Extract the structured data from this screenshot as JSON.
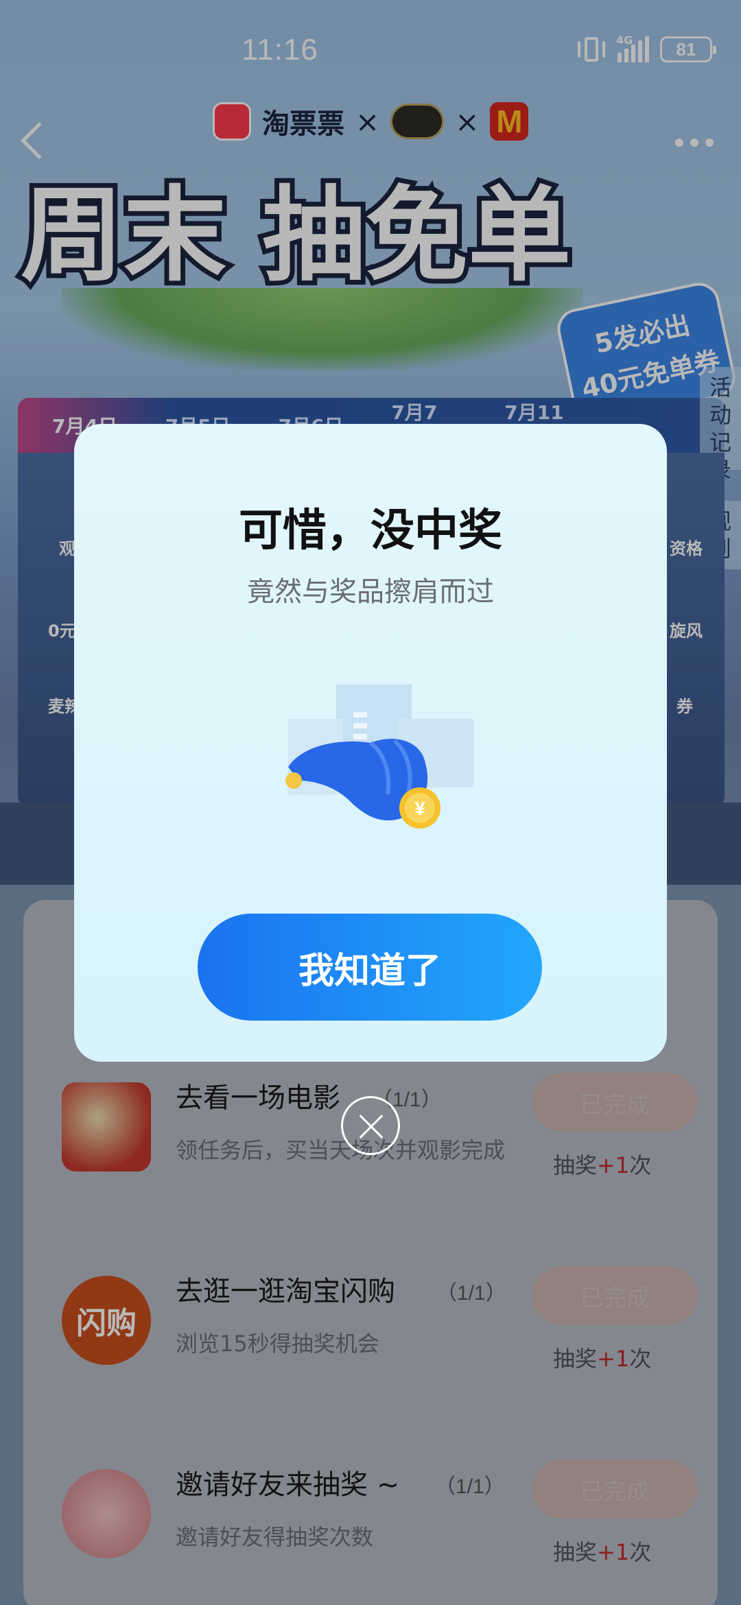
{
  "status_bar": {
    "time": "11:16",
    "network": "4G",
    "battery": "81"
  },
  "header": {
    "brand": "淘票票",
    "separator": "×",
    "mcd_logo": "M",
    "hero_title": "周末 抽免单",
    "promo_line1": "5发必出",
    "promo_line2": "40元免单券"
  },
  "date_tabs": [
    "7月4日",
    "7月5日",
    "7月6日",
    "7月7日-10日",
    "7月11日-13"
  ],
  "side_tabs": {
    "activity_record": "活动记录",
    "rules": "规则"
  },
  "machine_labels": [
    "观",
    "0元",
    "麦辣",
    "资格",
    "旋风",
    "券"
  ],
  "modal": {
    "title": "可惜，没中奖",
    "subtitle": "竟然与奖品擦肩而过",
    "coin_symbol": "¥",
    "confirm_label": "我知道了"
  },
  "tasks": [
    {
      "title": "去看一场电影",
      "progress": "（1/1）",
      "desc": "领任务后，买当天场次并观影完成",
      "button": "已完成",
      "reward_prefix": "抽奖",
      "reward_plus": "+1",
      "reward_suffix": "次"
    },
    {
      "title": "去逛一逛淘宝闪购",
      "progress": "（1/1）",
      "desc": "浏览15秒得抽奖机会",
      "button": "已完成",
      "reward_prefix": "抽奖",
      "reward_plus": "+1",
      "reward_suffix": "次",
      "thumb_text": "闪购"
    },
    {
      "title": "邀请好友来抽奖 ~",
      "progress": "（1/1）",
      "desc": "邀请好友得抽奖次数",
      "button": "已完成",
      "reward_prefix": "抽奖",
      "reward_plus": "+1",
      "reward_suffix": "次"
    }
  ],
  "icons": [
    "back-icon",
    "more-icon",
    "close-icon",
    "hand-coin-icon",
    "popcorn-icon",
    "handshake-icon"
  ],
  "colors": {
    "accent_blue": "#1a73f0",
    "reward_red": "#c0292e",
    "modal_bg": "#e3f7fd"
  }
}
